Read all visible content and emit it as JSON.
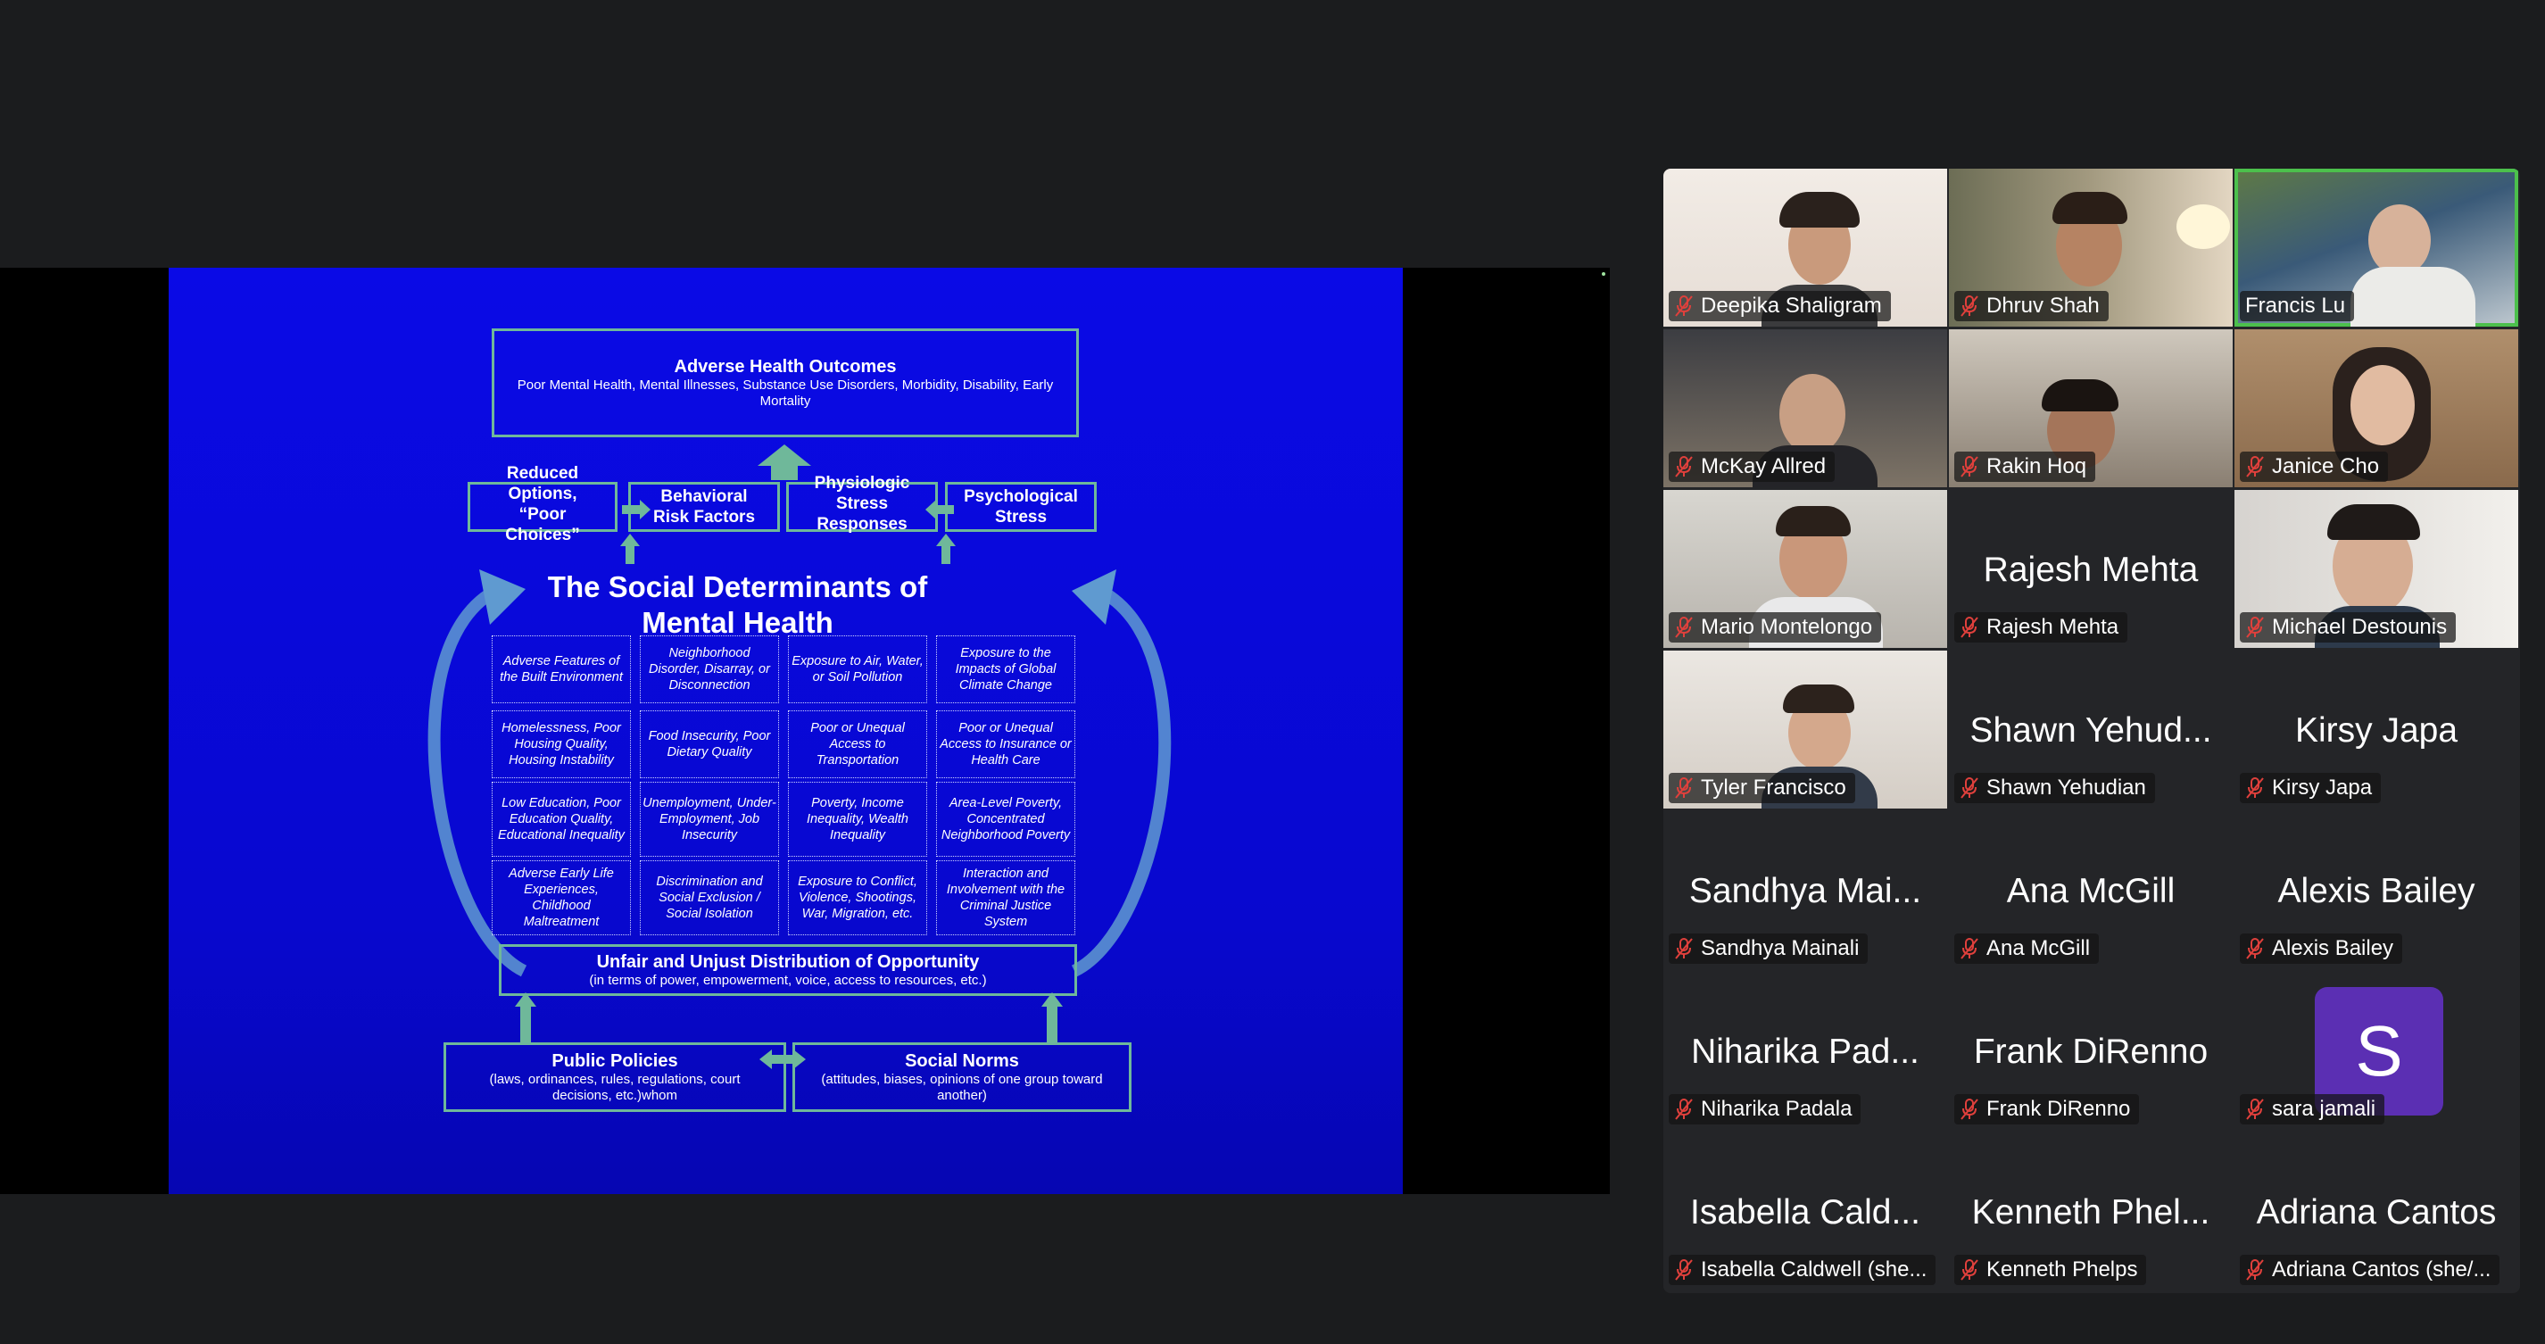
{
  "slide": {
    "outcome_title": "Adverse Health Outcomes",
    "outcome_sub": "Poor Mental Health, Mental Illnesses, Substance Use Disorders, Morbidity, Disability, Early Mortality",
    "pathways": [
      "Reduced Options, “Poor Choices”",
      "Behavioral Risk Factors",
      "Physiologic Stress Responses",
      "Psychological Stress"
    ],
    "title": "The Social Determinants of Mental Health",
    "determinants": [
      "Adverse Features of the Built Environment",
      "Neighborhood Disorder, Disarray, or Disconnection",
      "Exposure to Air, Water, or Soil Pollution",
      "Exposure to the Impacts of Global Climate Change",
      "Homelessness, Poor Housing Quality, Housing Instability",
      "Food Insecurity, Poor Dietary Quality",
      "Poor or Unequal Access to Transportation",
      "Poor or Unequal Access to Insurance or Health Care",
      "Low Education, Poor Education Quality, Educational Inequality",
      "Unemployment, Under-Employment, Job Insecurity",
      "Poverty, Income Inequality, Wealth Inequality",
      "Area-Level Poverty, Concentrated Neighborhood Poverty",
      "Adverse Early Life Experiences, Childhood Maltreatment",
      "Discrimination and Social Exclusion / Social Isolation",
      "Exposure to Conflict, Violence, Shootings, War, Migration, etc.",
      "Interaction and Involvement with the Criminal Justice System"
    ],
    "opportunity_title": "Unfair and Unjust Distribution of Opportunity",
    "opportunity_sub": "(in terms of power, empowerment, voice, access to resources, etc.)",
    "policies_title": "Public Policies",
    "policies_sub": "(laws, ordinances, rules, regulations, court decisions, etc.)whom",
    "norms_title": "Social Norms",
    "norms_sub": "(attitudes, biases, opinions of one group toward another)"
  },
  "gallery": {
    "tiles": [
      {
        "big": "",
        "label": "Deepika Shaligram",
        "muted": true,
        "video": true
      },
      {
        "big": "",
        "label": "Dhruv Shah",
        "muted": true,
        "video": true
      },
      {
        "big": "",
        "label": "Francis Lu",
        "muted": false,
        "video": true,
        "active": true
      },
      {
        "big": "",
        "label": "McKay Allred",
        "muted": true,
        "video": true
      },
      {
        "big": "",
        "label": "Rakin Hoq",
        "muted": true,
        "video": true
      },
      {
        "big": "",
        "label": "Janice Cho",
        "muted": true,
        "video": true
      },
      {
        "big": "",
        "label": "Mario Montelongo",
        "muted": true,
        "video": true
      },
      {
        "big": "Rajesh Mehta",
        "label": "Rajesh Mehta",
        "muted": true,
        "video": false
      },
      {
        "big": "",
        "label": "Michael Destounis",
        "muted": true,
        "video": true
      },
      {
        "big": "",
        "label": "Tyler Francisco",
        "muted": true,
        "video": true
      },
      {
        "big": "Shawn Yehud...",
        "label": "Shawn Yehudian",
        "muted": true,
        "video": false
      },
      {
        "big": "Kirsy Japa",
        "label": "Kirsy Japa",
        "muted": true,
        "video": false
      },
      {
        "big": "Sandhya Mai...",
        "label": "Sandhya Mainali",
        "muted": true,
        "video": false
      },
      {
        "big": "Ana McGill",
        "label": "Ana McGill",
        "muted": true,
        "video": false
      },
      {
        "big": "Alexis Bailey",
        "label": "Alexis Bailey",
        "muted": true,
        "video": false
      },
      {
        "big": "Niharika Pad...",
        "label": "Niharika Padala",
        "muted": true,
        "video": false
      },
      {
        "big": "Frank DiRenno",
        "label": "Frank DiRenno",
        "muted": true,
        "video": false
      },
      {
        "big": "",
        "label": "sara jamali",
        "muted": true,
        "video": false,
        "avatar": "S"
      },
      {
        "big": "Isabella Cald...",
        "label": "Isabella Caldwell (she...",
        "muted": true,
        "video": false
      },
      {
        "big": "Kenneth Phel...",
        "label": "Kenneth Phelps",
        "muted": true,
        "video": false
      },
      {
        "big": "Adriana Cantos",
        "label": "Adriana Cantos (she/...",
        "muted": true,
        "video": false
      }
    ]
  },
  "colors": {
    "slide_blue": "#0a0ae6",
    "box_border": "#6fb89a",
    "active_speaker": "#4cc04c",
    "muted_icon": "#e0403c",
    "avatar_bg": "#5b2fb3"
  },
  "icons": {
    "muted": "microphone-muted-icon"
  }
}
